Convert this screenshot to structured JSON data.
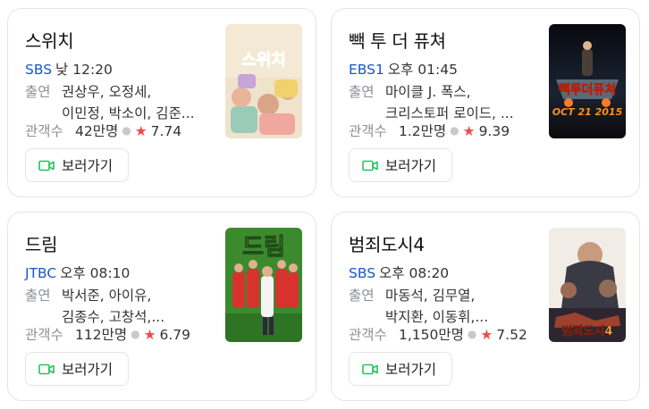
{
  "cards": [
    {
      "title": "스위치",
      "channel": "SBS",
      "time": "낮 12:20",
      "cast_label": "출연",
      "cast_line1": "권상우, 오정세,",
      "cast_line2": "이민정, 박소이, 김준...",
      "audience_label": "관객수",
      "audience": "42만명",
      "rating": "7.74",
      "button_label": "보러가기",
      "poster_text": "스위치"
    },
    {
      "title": "빽 투 더 퓨쳐",
      "channel": "EBS1",
      "time": "오후 01:45",
      "cast_label": "출연",
      "cast_line1": "마이클 J. 폭스,",
      "cast_line2": "크리스토퍼 로이드, ...",
      "audience_label": "관객수",
      "audience": "1.2만명",
      "rating": "9.39",
      "button_label": "보러가기",
      "poster_text": "빽투더퓨쳐"
    },
    {
      "title": "드림",
      "channel": "JTBC",
      "time": "오후 08:10",
      "cast_label": "출연",
      "cast_line1": "박서준, 아이유,",
      "cast_line2": "김종수, 고창석,...",
      "audience_label": "관객수",
      "audience": "112만명",
      "rating": "6.79",
      "button_label": "보러가기",
      "poster_text": "드림"
    },
    {
      "title": "범죄도시4",
      "channel": "SBS",
      "time": "오후 08:20",
      "cast_label": "출연",
      "cast_line1": "마동석, 김무열,",
      "cast_line2": "박지환, 이동휘,...",
      "audience_label": "관객수",
      "audience": "1,150만명",
      "rating": "7.52",
      "button_label": "보러가기",
      "poster_text": "범죄도시4"
    }
  ],
  "icons": {
    "video": "video-camera-icon",
    "star": "star-icon"
  },
  "colors": {
    "channel": "#1a57c9",
    "star": "#f2494e",
    "button_icon": "#22c55e",
    "label": "#8b8f94"
  }
}
